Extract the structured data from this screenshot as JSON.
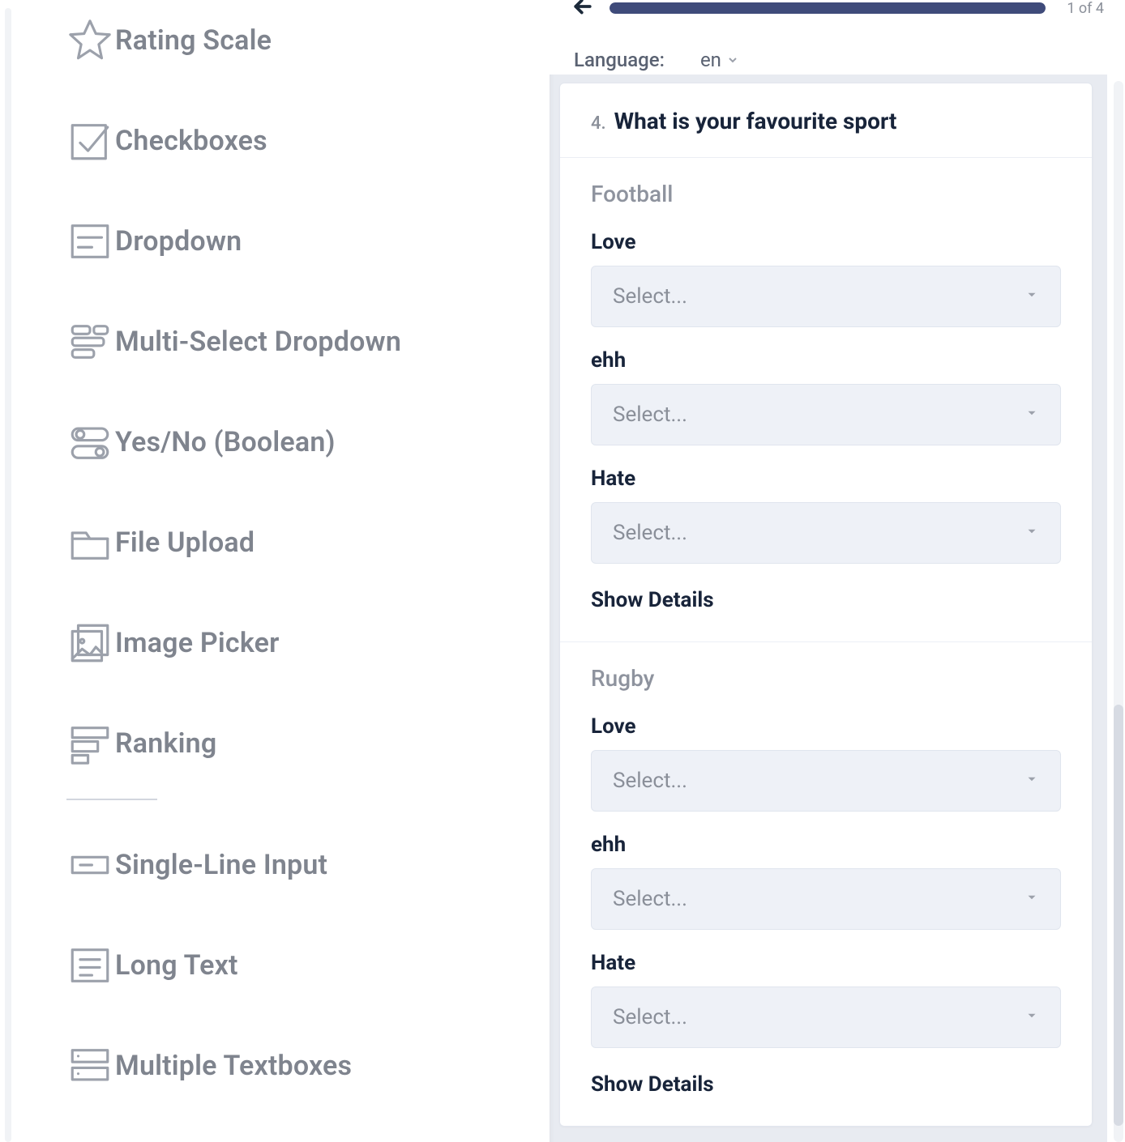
{
  "sidebar": {
    "items": [
      {
        "key": "rating-scale",
        "label": "Rating Scale",
        "icon": "star"
      },
      {
        "key": "checkboxes",
        "label": "Checkboxes",
        "icon": "check-square"
      },
      {
        "key": "dropdown",
        "label": "Dropdown",
        "icon": "dropdown"
      },
      {
        "key": "multi-select-dropdown",
        "label": "Multi-Select Dropdown",
        "icon": "multi"
      },
      {
        "key": "boolean",
        "label": "Yes/No (Boolean)",
        "icon": "toggle"
      },
      {
        "key": "file-upload",
        "label": "File Upload",
        "icon": "folder"
      },
      {
        "key": "image-picker",
        "label": "Image Picker",
        "icon": "image"
      },
      {
        "key": "ranking",
        "label": "Ranking",
        "icon": "rank"
      },
      {
        "separator": true
      },
      {
        "key": "single-line",
        "label": "Single-Line Input",
        "icon": "sline"
      },
      {
        "key": "long-text",
        "label": "Long Text",
        "icon": "ltext"
      },
      {
        "key": "multi-text",
        "label": "Multiple Textboxes",
        "icon": "mtext"
      }
    ]
  },
  "preview": {
    "page_counter": "1 of 4",
    "language_label": "Language:",
    "language_value": "en",
    "question": {
      "number": "4.",
      "title": "What is your favourite sport"
    },
    "groups": [
      {
        "name": "Football",
        "fields": [
          {
            "label": "Love",
            "placeholder": "Select..."
          },
          {
            "label": "ehh",
            "placeholder": "Select..."
          },
          {
            "label": "Hate",
            "placeholder": "Select..."
          }
        ],
        "show_details_label": "Show Details"
      },
      {
        "name": "Rugby",
        "fields": [
          {
            "label": "Love",
            "placeholder": "Select..."
          },
          {
            "label": "ehh",
            "placeholder": "Select..."
          },
          {
            "label": "Hate",
            "placeholder": "Select..."
          }
        ],
        "show_details_label": "Show Details"
      }
    ]
  }
}
